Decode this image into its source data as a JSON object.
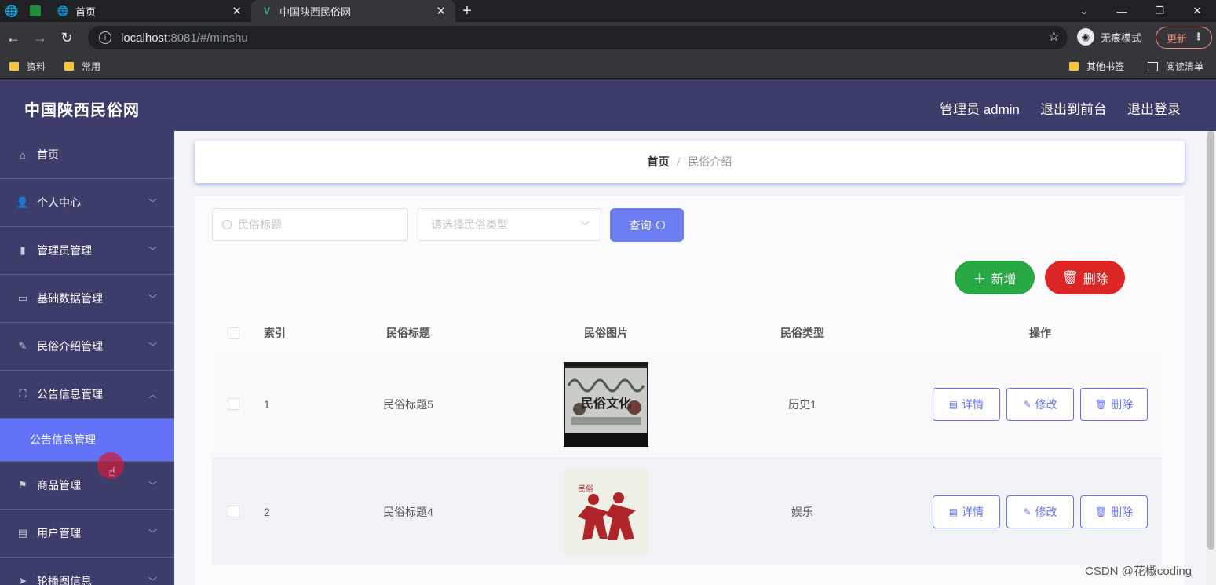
{
  "browser": {
    "tabs": [
      {
        "title": "首页"
      },
      {
        "title": "中国陕西民俗网"
      }
    ],
    "new_tab_symbol": "+",
    "url_host": "localhost",
    "url_path": ":8081/#/minshu",
    "incognito_label": "无痕模式",
    "update_label": "更新",
    "bookmarks": [
      "资料",
      "常用"
    ],
    "bookmarks_right": [
      "其他书签",
      "阅读清单"
    ]
  },
  "header": {
    "site_title": "中国陕西民俗网",
    "admin_label": "管理员 admin",
    "exit_front": "退出到前台",
    "logout": "退出登录"
  },
  "sidebar": {
    "items": [
      {
        "label": "首页",
        "icon": "home-icon",
        "has_children": false
      },
      {
        "label": "个人中心",
        "icon": "user-icon",
        "has_children": true
      },
      {
        "label": "管理员管理",
        "icon": "bar-chart-icon",
        "has_children": true
      },
      {
        "label": "基础数据管理",
        "icon": "card-icon",
        "has_children": true
      },
      {
        "label": "民俗介绍管理",
        "icon": "edit-icon",
        "has_children": true
      },
      {
        "label": "公告信息管理",
        "icon": "fullscreen-icon",
        "has_children": true,
        "expanded": true
      },
      {
        "label": "商品管理",
        "icon": "flag-icon",
        "has_children": true
      },
      {
        "label": "用户管理",
        "icon": "printer-icon",
        "has_children": true
      },
      {
        "label": "轮播图信息",
        "icon": "send-icon",
        "has_children": true
      }
    ],
    "active_submenu": "公告信息管理"
  },
  "breadcrumb": {
    "home": "首页",
    "separator": "/",
    "current": "民俗介绍"
  },
  "search": {
    "title_placeholder": "民俗标题",
    "type_placeholder": "请选择民俗类型",
    "query_label": "查询"
  },
  "actions": {
    "add_label": "新增",
    "delete_label": "删除"
  },
  "table": {
    "columns": [
      "索引",
      "民俗标题",
      "民俗图片",
      "民俗类型",
      "操作"
    ],
    "rows": [
      {
        "index": "1",
        "title": "民俗标题5",
        "type": "历史1",
        "image": "folk-culture-poster"
      },
      {
        "index": "2",
        "title": "民俗标题4",
        "type": "娱乐",
        "image": "paper-cut-dancers"
      }
    ],
    "op_labels": {
      "detail": "详情",
      "edit": "修改",
      "delete": "删除"
    }
  },
  "image_texts": {
    "poster_caption": "民俗文化",
    "papercut_caption": "民俗"
  },
  "watermark": "CSDN @花椒coding",
  "colors": {
    "header_bg": "#3c3d6b",
    "accent": "#6271f5",
    "add_green": "#27a844",
    "delete_red": "#dc2626"
  }
}
